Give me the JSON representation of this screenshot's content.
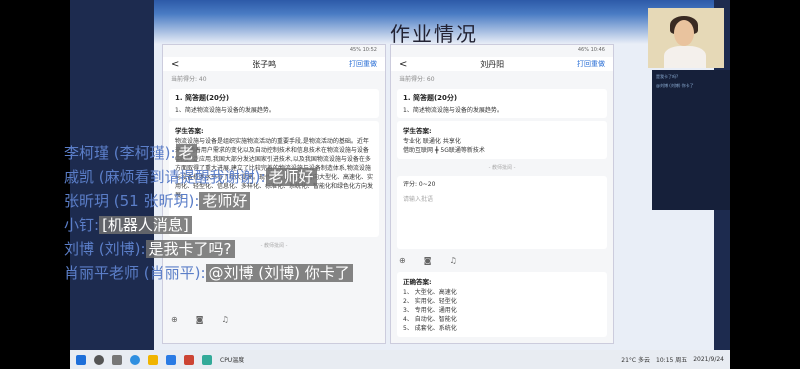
{
  "slide": {
    "title": "作业情况"
  },
  "left_phone": {
    "status": "45% 10:52",
    "back": "<",
    "student": "张子鸣",
    "action": "打回重做",
    "score": "当前得分: 40",
    "question_title": "1. 简答题(20分)",
    "question_text": "1、简述物流设施与设备的发展趋势。",
    "answer_header": "学生答案:",
    "answer_text": "物流设施与设备是组织实施物流活动的重要手段,是物流活动的基础。近年来,伴随着用户需求的变化以及自动控制技术和信息技术在物流设施与设备中的广泛应用,我国大部分发达国家引进技术,以及我国物流设施与设备在多方面取得了重大进展,建立了比较完善的物流设施与设备制造体系,物流设施与设备技术水平有了较大提高。现代物流设施与设备向大型化、高速化、实用化、轻型化、信息化、多样化、标准化、系统化、智能化和绿色化方向发展。",
    "divider": "- 教师批阅 -"
  },
  "right_phone": {
    "status": "46% 10:46",
    "back": "<",
    "student": "刘丹阳",
    "action": "打回重做",
    "score": "当前得分: 60",
    "question_title": "1. 简答题(20分)",
    "question_text": "1、简述物流设施与设备的发展趋势。",
    "answer_header": "学生答案:",
    "answer_lines": [
      "专业化 联通化 共享化",
      "借助互联网 ╋ 5G联通等新技术"
    ],
    "divider": "- 教师批阅 -",
    "rating_label": "评分: 0~20",
    "comment_placeholder": "请输入批语",
    "correct_header": "正确答案:",
    "correct_lines": [
      "1、 大型化、高速化",
      "2、 实用化、轻型化",
      "3、 专用化、通用化",
      "4、 自动化、智能化",
      "5、 成套化、系统化"
    ]
  },
  "chat_overlay": [
    {
      "name": "李柯瑾 (李柯瑾):",
      "text": "老"
    },
    {
      "name": "戚凯 (麻烦看到请提醒我谢谢):",
      "text": "老师好"
    },
    {
      "name": "张昕玥 (51 张昕玥):",
      "text": "老师好"
    },
    {
      "name": "小钉:",
      "text": "[机器人消息]"
    },
    {
      "name": "刘博 (刘博):",
      "text": "是我卡了吗?"
    },
    {
      "name": "肖丽平老师 (肖丽平):",
      "text": "@刘博 (刘博) 你卡了"
    }
  ],
  "side_chat": [
    "是我卡了吗?",
    "@刘博 (刘博) 你卡了"
  ],
  "taskbar": {
    "weather": "21°C 多云",
    "time": "10:15 周五",
    "date": "2021/9/24",
    "cpu": "CPU温度"
  }
}
